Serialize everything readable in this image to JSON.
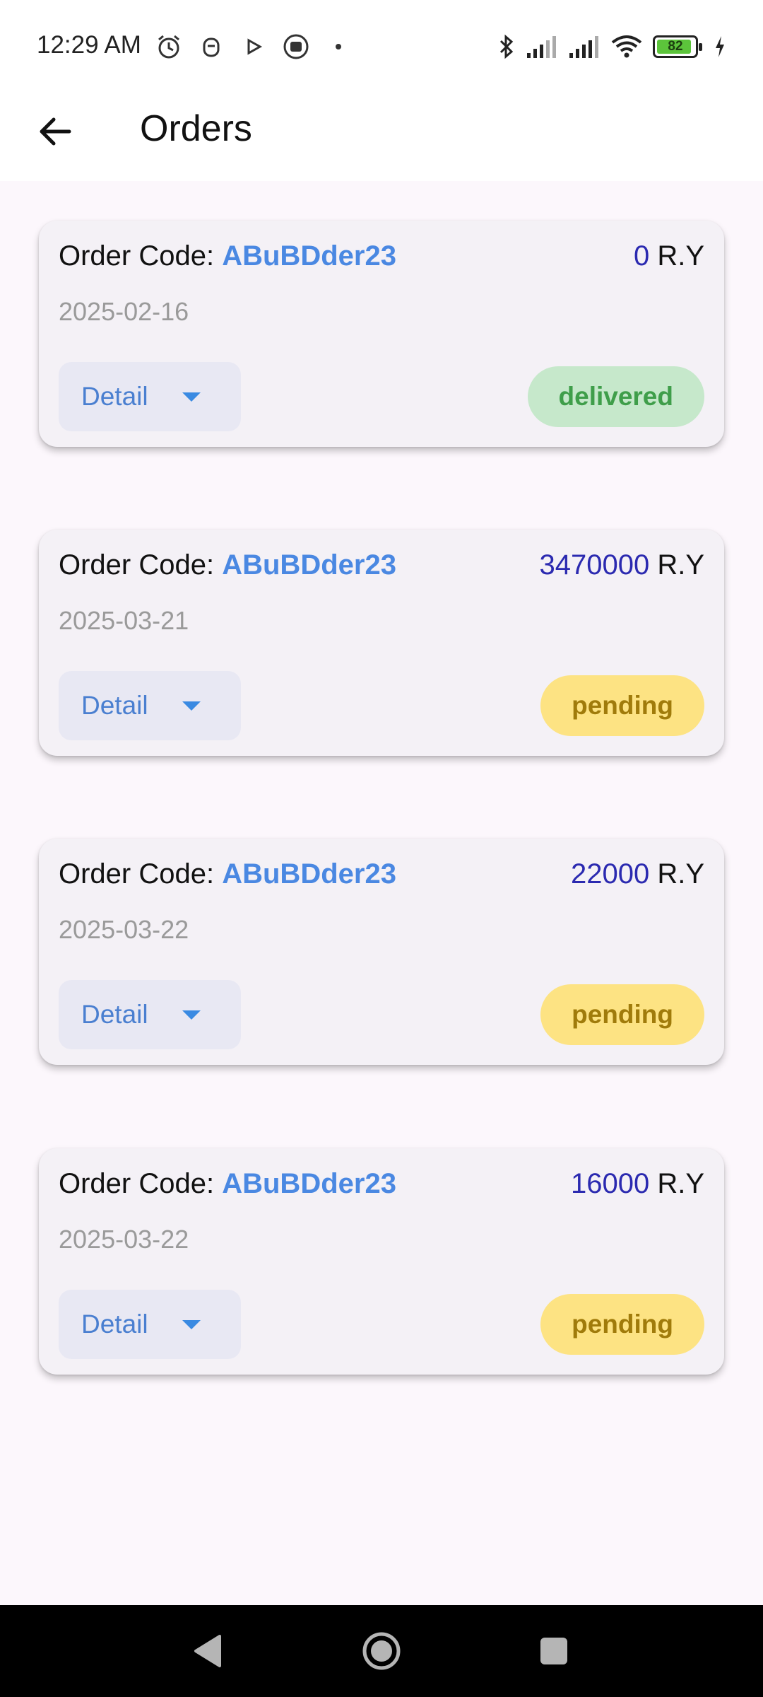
{
  "status_bar": {
    "time": "12:29 AM",
    "battery_level": "82",
    "icons_left": [
      "alarm-icon",
      "app-notification-icon",
      "play-icon",
      "media-icon",
      "dot-icon"
    ],
    "icons_right": [
      "bluetooth-icon",
      "signal-icon",
      "signal-icon",
      "wifi-icon",
      "battery-icon",
      "charging-icon"
    ]
  },
  "app_bar": {
    "title": "Orders",
    "back_icon": "arrow-left-icon"
  },
  "orders": [
    {
      "code_label": "Order Code: ",
      "code": "ABuBDder23",
      "amount": "0",
      "currency": " R.Y",
      "date": "2025-02-16",
      "detail_label": "Detail",
      "status": "delivered"
    },
    {
      "code_label": "Order Code: ",
      "code": "ABuBDder23",
      "amount": "3470000",
      "currency": " R.Y",
      "date": "2025-03-21",
      "detail_label": "Detail",
      "status": "pending"
    },
    {
      "code_label": "Order Code: ",
      "code": "ABuBDder23",
      "amount": "22000",
      "currency": " R.Y",
      "date": "2025-03-22",
      "detail_label": "Detail",
      "status": "pending"
    },
    {
      "code_label": "Order Code: ",
      "code": "ABuBDder23",
      "amount": "16000",
      "currency": " R.Y",
      "date": "2025-03-22",
      "detail_label": "Detail",
      "status": "pending"
    }
  ],
  "colors": {
    "order_code": "#4a88e2",
    "amount": "#2b2ab0",
    "delivered_bg": "#c6e8cb",
    "pending_bg": "#fde383"
  },
  "nav_bar": {
    "buttons": [
      "back-triangle-icon",
      "home-circle-icon",
      "recents-square-icon"
    ]
  }
}
